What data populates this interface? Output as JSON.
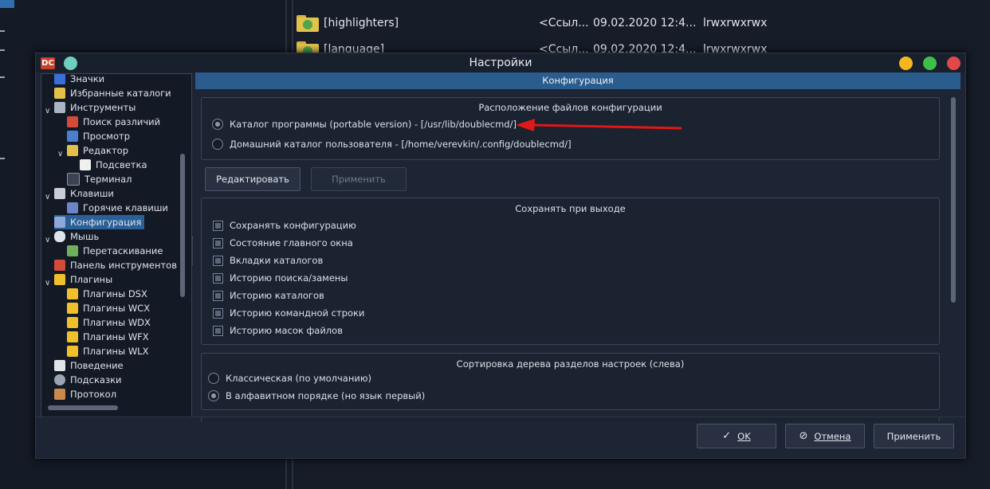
{
  "background": {
    "files": [
      {
        "name": "[highlighters]",
        "type": "<Ссыл...",
        "date": "09.02.2020 12:4...",
        "attr": "lrwxrwxrwx"
      },
      {
        "name": "[language]",
        "type": "<Ссыл...",
        "date": "09.02.2020 12:4...",
        "attr": "lrwxrwxrwx"
      }
    ]
  },
  "dialog": {
    "title": "Настройки",
    "app_logo": "DC",
    "window_buttons": {
      "minimize": "#f5b81c",
      "maximize": "#3fbf4a",
      "close": "#e2474a",
      "extra": "#6fcfbf"
    }
  },
  "tree": {
    "items": [
      {
        "label": "Значки",
        "icon": "icons-icon",
        "color": "#3a6fd8"
      },
      {
        "label": "Избранные каталоги",
        "icon": "favorites-icon",
        "color": "#e3c04b"
      },
      {
        "label": "Инструменты",
        "icon": "tools-icon",
        "color": "#aab4c2",
        "expanded": true
      },
      {
        "label": "Поиск различий",
        "icon": "diff-icon",
        "color": "#d44b3a"
      },
      {
        "label": "Просмотр",
        "icon": "viewer-icon",
        "color": "#4a7fd0"
      },
      {
        "label": "Редактор",
        "icon": "editor-icon",
        "color": "#e3c04b",
        "expanded": true
      },
      {
        "label": "Подсветка",
        "icon": "highlight-icon",
        "color": "#f0f0f0"
      },
      {
        "label": "Терминал",
        "icon": "terminal-icon",
        "color": "#3b4252"
      },
      {
        "label": "Клавиши",
        "icon": "keyboard-icon",
        "color": "#c7ccd5",
        "expanded": true
      },
      {
        "label": "Горячие клавиши",
        "icon": "hotkeys-icon",
        "color": "#6a86c8"
      },
      {
        "label": "Конфигурация",
        "icon": "configuration-icon",
        "color": "#8fa8d8",
        "selected": true
      },
      {
        "label": "Мышь",
        "icon": "mouse-icon",
        "color": "#dfe3ea",
        "expanded": true
      },
      {
        "label": "Перетаскивание",
        "icon": "drag-drop-icon",
        "color": "#6fae5a"
      },
      {
        "label": "Панель инструментов",
        "icon": "toolbar-icon",
        "color": "#d44b3a"
      },
      {
        "label": "Плагины",
        "icon": "plugins-icon",
        "color": "#f0c02a",
        "expanded": true
      },
      {
        "label": "Плагины DSX",
        "icon": "plugin-icon",
        "color": "#f0c02a"
      },
      {
        "label": "Плагины WCX",
        "icon": "plugin-icon",
        "color": "#f0c02a"
      },
      {
        "label": "Плагины WDX",
        "icon": "plugin-icon",
        "color": "#f0c02a"
      },
      {
        "label": "Плагины WFX",
        "icon": "plugin-icon",
        "color": "#f0c02a"
      },
      {
        "label": "Плагины WLX",
        "icon": "plugin-icon",
        "color": "#f0c02a"
      },
      {
        "label": "Поведение",
        "icon": "behavior-icon",
        "color": "#dfe3ea"
      },
      {
        "label": "Подсказки",
        "icon": "tooltips-icon",
        "color": "#9aa4b2"
      },
      {
        "label": "Протокол",
        "icon": "log-icon",
        "color": "#c98a4a"
      }
    ],
    "expand_symbol": "∨"
  },
  "page": {
    "header": "Конфигурация",
    "location": {
      "title": "Расположение файлов конфигурации",
      "options": [
        {
          "label": "Каталог программы (portable version) - [/usr/lib/doublecmd/]",
          "selected": true
        },
        {
          "label": "Домашний каталог пользователя - [/home/verevkin/.config/doublecmd/]",
          "selected": false
        }
      ]
    },
    "edit_button": "Редактировать",
    "apply_inline_button": "Применить",
    "save_on_exit": {
      "title": "Сохранять при выходе",
      "items": [
        {
          "label": "Сохранять конфигурацию",
          "checked": true
        },
        {
          "label": "Состояние главного окна",
          "checked": true
        },
        {
          "label": "Вкладки каталогов",
          "checked": true
        },
        {
          "label": "Историю поиска/замены",
          "checked": true
        },
        {
          "label": "Историю каталогов",
          "checked": true
        },
        {
          "label": "Историю командной строки",
          "checked": true
        },
        {
          "label": "Историю масок файлов",
          "checked": true
        }
      ]
    },
    "tree_sort": {
      "title": "Сортировка дерева разделов настроек (слева)",
      "options": [
        {
          "label": "Классическая (по умолчанию)",
          "selected": false
        },
        {
          "label": "В алфавитном порядке (но язык первый)",
          "selected": true
        }
      ]
    }
  },
  "footer": {
    "ok_button": "OK",
    "ok_icon": "✓",
    "cancel_button": "Отмена",
    "cancel_icon": "⊘",
    "apply_button": "Применить"
  },
  "annotation": {
    "color": "#e01818"
  }
}
